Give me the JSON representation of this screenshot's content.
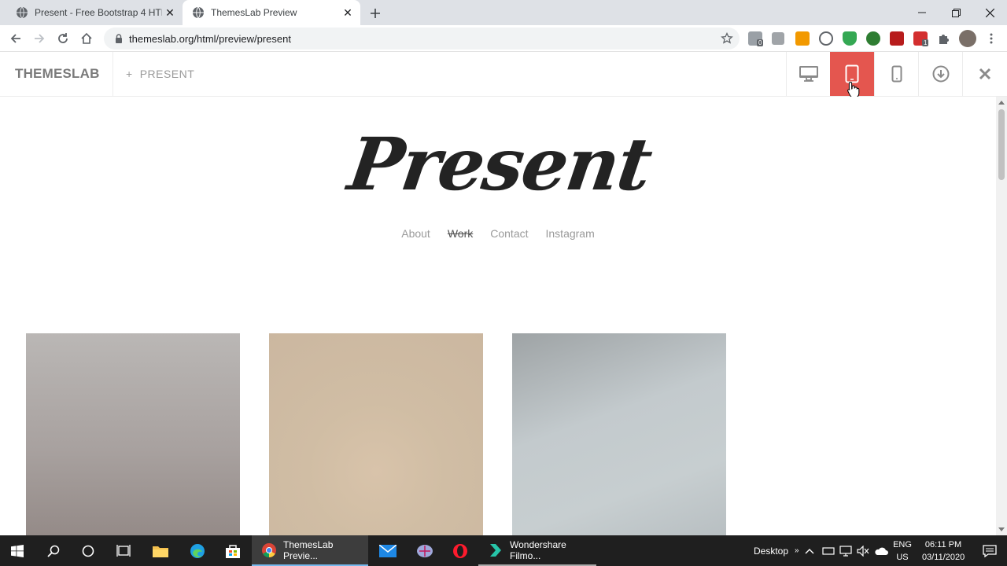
{
  "browser": {
    "tabs": [
      {
        "title": "Present - Free Bootstrap 4 HTML",
        "active": false
      },
      {
        "title": "ThemesLab Preview",
        "active": true
      }
    ],
    "url": "themeslab.org/html/preview/present",
    "extension_badges": [
      "0",
      "1"
    ]
  },
  "previewbar": {
    "brand": "THEMESLAB",
    "crumb": "PRESENT",
    "crumb_icon": "plus-icon",
    "buttons": [
      {
        "name": "desktop-view",
        "icon": "monitor-icon",
        "active": false
      },
      {
        "name": "tablet-view",
        "icon": "tablet-icon",
        "active": true
      },
      {
        "name": "mobile-view",
        "icon": "phone-icon",
        "active": false
      },
      {
        "name": "download",
        "icon": "download-icon",
        "active": false
      },
      {
        "name": "close-preview",
        "icon": "close-icon",
        "active": false
      }
    ],
    "accent": "#e4564f"
  },
  "site": {
    "logo": "Present",
    "nav": [
      {
        "label": "About",
        "current": false
      },
      {
        "label": "Work",
        "current": true
      },
      {
        "label": "Contact",
        "current": false
      },
      {
        "label": "Instagram",
        "current": false
      }
    ]
  },
  "taskbar": {
    "apps": [
      {
        "label": "ThemesLab Previe...",
        "icon": "chrome-icon"
      },
      {
        "label": "Wondershare Filmo...",
        "icon": "filmora-icon"
      }
    ],
    "desktop_label": "Desktop",
    "lang": "ENG",
    "region": "US",
    "time": "06:11 PM",
    "date": "03/11/2020"
  }
}
